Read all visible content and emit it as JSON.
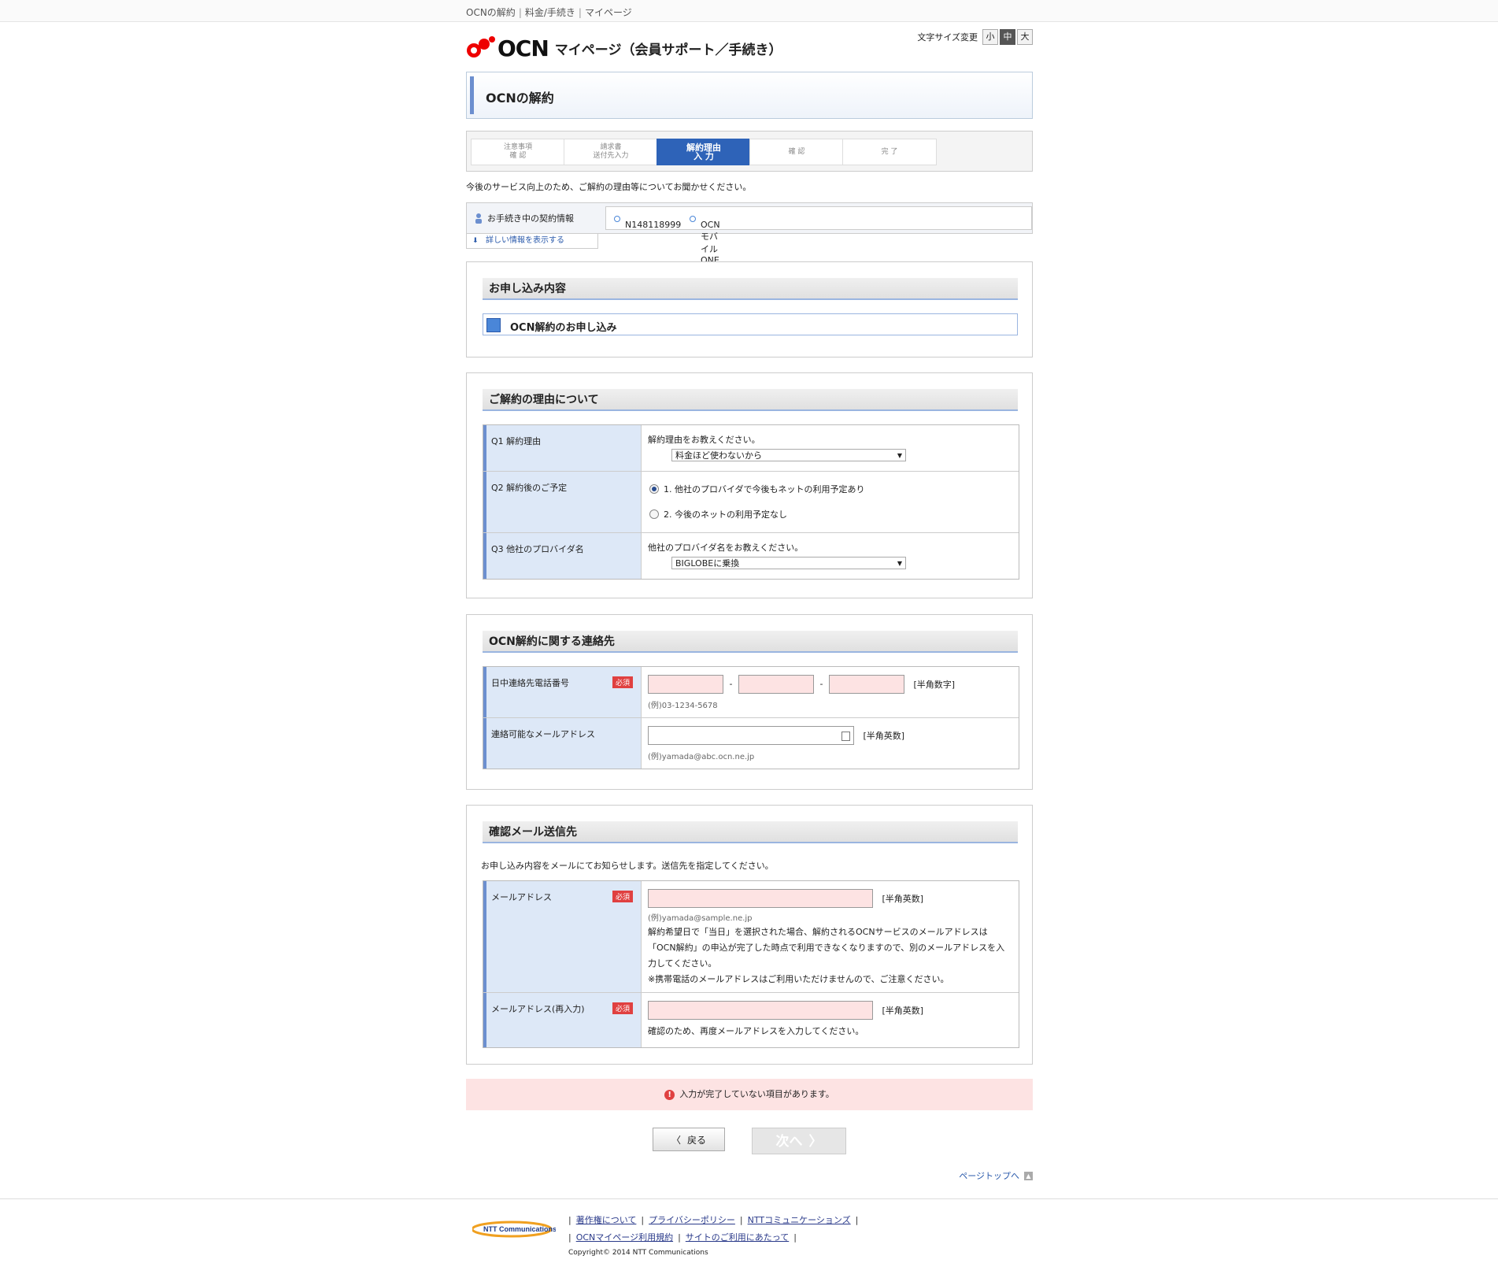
{
  "breadcrumb": {
    "items": [
      "OCNの解約",
      "料金/手続き",
      "マイページ"
    ]
  },
  "header": {
    "brand": "OCN",
    "subtitle": "マイページ（会員サポート／手続き）"
  },
  "font_size": {
    "label": "文字サイズ変更",
    "small": "小",
    "medium": "中",
    "large": "大",
    "active": "medium"
  },
  "page_title": "OCNの解約",
  "steps": [
    {
      "line1": "注意事項",
      "line2": "確 認"
    },
    {
      "line1": "請求書",
      "line2": "送付先入力"
    },
    {
      "line1": "解約理由",
      "line2": "入 力"
    },
    {
      "line1": "確 認",
      "line2": ""
    },
    {
      "line1": "完 了",
      "line2": ""
    }
  ],
  "intro": "今後のサービス向上のため、ご解約の理由等についてお聞かせください。",
  "contract": {
    "label": "お手続き中の契約情報",
    "id": "N148118999",
    "service": "OCN モバイル ONE",
    "detail_link": "詳しい情報を表示する"
  },
  "application": {
    "heading": "お申し込み内容",
    "item": "OCN解約のお申し込み"
  },
  "reason": {
    "heading": "ご解約の理由について",
    "q1": {
      "label": "Q1 解約理由",
      "prompt": "解約理由をお教えください。",
      "selected": "料金ほど使わないから"
    },
    "q2": {
      "label": "Q2 解約後のご予定",
      "option1": "1. 他社のプロバイダで今後もネットの利用予定あり",
      "option2": "2. 今後のネットの利用予定なし",
      "selected": 1
    },
    "q3": {
      "label": "Q3 他社のプロバイダ名",
      "prompt": "他社のプロバイダ名をお教えください。",
      "selected": "BIGLOBEに乗換"
    }
  },
  "contact": {
    "heading": "OCN解約に関する連絡先",
    "phone_label": "日中連絡先電話番号",
    "required": "必須",
    "phone_unit": "[半角数字]",
    "phone_example": "(例)03-1234-5678",
    "email_label": "連絡可能なメールアドレス",
    "email_unit": "[半角英数]",
    "email_example": "(例)yamada@abc.ocn.ne.jp",
    "separator": "-"
  },
  "confirm_mail": {
    "heading": "確認メール送信先",
    "intro": "お申し込み内容をメールにてお知らせします。送信先を指定してください。",
    "email_label": "メールアドレス",
    "required": "必須",
    "unit": "[半角英数]",
    "example": "(例)yamada@sample.ne.jp",
    "note1": "解約希望日で「当日」を選択された場合、解約されるOCNサービスのメールアドレスは「OCN解約」の申込が完了した時点で利用できなくなりますので、別のメールアドレスを入力してください。",
    "note2": "※携帯電話のメールアドレスはご利用いただけませんので、ご注意ください。",
    "reenter_label": "メールアドレス(再入力)",
    "reenter_note": "確認のため、再度メールアドレスを入力してください。"
  },
  "alert": "入力が完了していない項目があります。",
  "buttons": {
    "back": "戻る",
    "next": "次へ"
  },
  "page_top": "ページトップへ",
  "footer": {
    "links": [
      "著作権について",
      "プライバシーポリシー",
      "NTTコミュニケーションズ",
      "OCNマイページ利用規約",
      "サイトのご利用にあたって"
    ],
    "copyright": "Copyright© 2014  NTT Communications",
    "ntt_logo_text": "NTT Communications"
  }
}
